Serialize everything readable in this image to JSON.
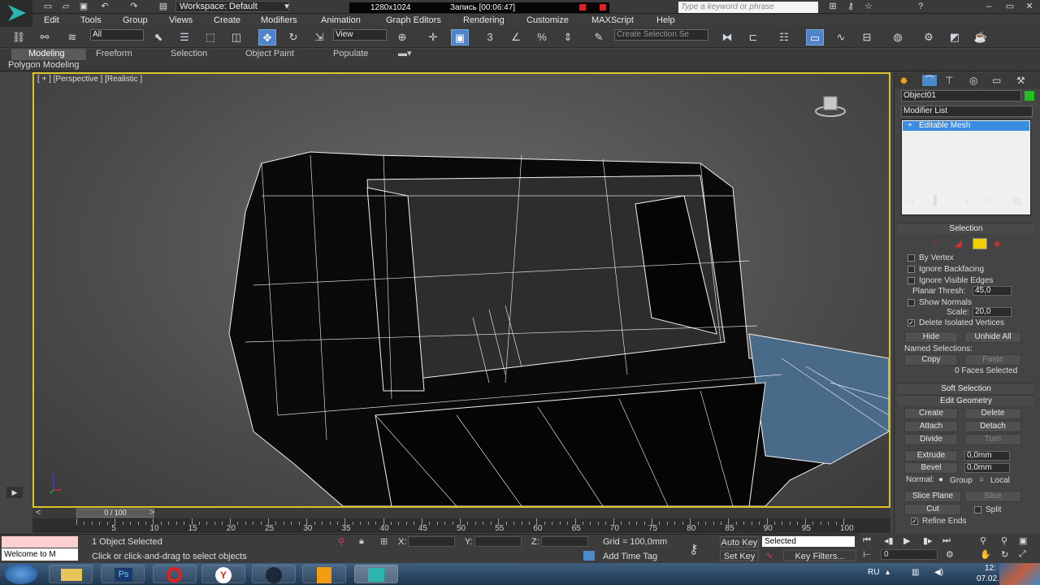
{
  "title_bar": {
    "workspace": "Workspace: Default",
    "resolution": "1280x1024",
    "recording": "Запись [00:06:47]",
    "search_placeholder": "Type a keyword or phrase"
  },
  "menu": [
    "Edit",
    "Tools",
    "Group",
    "Views",
    "Create",
    "Modifiers",
    "Animation",
    "Graph Editors",
    "Rendering",
    "Customize",
    "MAXScript",
    "Help"
  ],
  "toolbar": {
    "selection_filter": "All",
    "ref_coord": "View",
    "named_selection_placeholder": "Create Selection Se"
  },
  "ribbon": {
    "tabs": [
      "Modeling",
      "Freeform",
      "Selection",
      "Object Paint",
      "Populate"
    ],
    "active_tab": "Modeling",
    "subtitle": "Polygon Modeling"
  },
  "viewport": {
    "label": "[ + ] [Perspective ] [Realistic ]"
  },
  "command_panel": {
    "object_name": "Object01",
    "modifier_list": "Modifier List",
    "stack_item": "Editable Mesh",
    "selection": {
      "title": "Selection",
      "by_vertex": "By Vertex",
      "ignore_backfacing": "Ignore Backfacing",
      "ignore_visible_edges": "Ignore Visible Edges",
      "planar_thresh_label": "Planar Thresh:",
      "planar_thresh_value": "45,0",
      "show_normals": "Show Normals",
      "scale_label": "Scale:",
      "scale_value": "20,0",
      "delete_isolated": "Delete Isolated Vertices",
      "hide": "Hide",
      "unhide_all": "Unhide All",
      "named_selections": "Named Selections:",
      "copy": "Copy",
      "paste": "Paste",
      "faces_selected": "0 Faces Selected"
    },
    "soft_selection": "Soft Selection",
    "edit_geometry": {
      "title": "Edit Geometry",
      "create": "Create",
      "delete": "Delete",
      "attach": "Attach",
      "detach": "Detach",
      "divide": "Divide",
      "turn": "Turn",
      "extrude": "Extrude",
      "extrude_value": "0,0mm",
      "bevel": "Bevel",
      "bevel_value": "0,0mm",
      "normal_label": "Normal:",
      "group": "Group",
      "local": "Local",
      "slice_plane": "Slice Plane",
      "slice": "Slice",
      "cut": "Cut",
      "split": "Split",
      "refine_ends": "Refine Ends"
    }
  },
  "timeline": {
    "frame_counter": "0 / 100",
    "ticks": [
      "5",
      "10",
      "15",
      "20",
      "25",
      "30",
      "35",
      "40",
      "45",
      "50",
      "55",
      "60",
      "65",
      "70",
      "75",
      "80",
      "85",
      "90",
      "95",
      "100"
    ]
  },
  "status": {
    "welcome": "Welcome to M",
    "objects_selected": "1 Object Selected",
    "prompt": "Click or click-and-drag to select objects",
    "x_label": "X:",
    "y_label": "Y:",
    "z_label": "Z:",
    "grid": "Grid = 100,0mm",
    "add_time_tag": "Add Time Tag",
    "auto_key": "Auto Key",
    "selected_dropdown": "Selected",
    "set_key": "Set Key",
    "key_filters": "Key Filters...",
    "frame_value": "0"
  },
  "taskbar": {
    "lang": "RU",
    "time": "12:",
    "date": "07.02."
  }
}
